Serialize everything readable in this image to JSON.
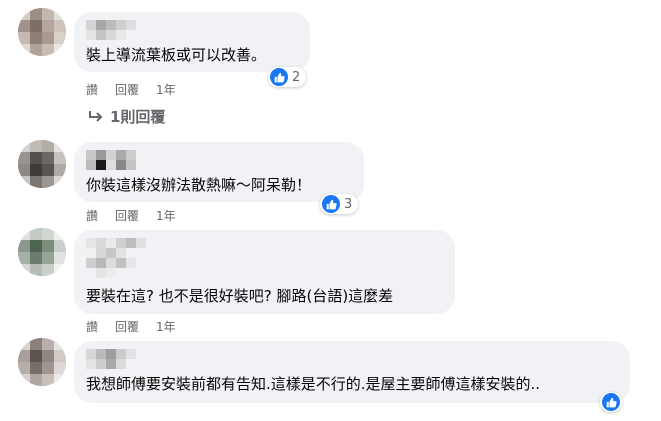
{
  "comments": [
    {
      "text": "裝上導流葉板或可以改善。",
      "reaction_count": "2",
      "actions": {
        "like": "讚",
        "reply": "回覆",
        "time": "1年"
      },
      "replies_label": "1則回覆"
    },
    {
      "text": "你裝這樣沒辦法散熱嘛～阿呆勒！",
      "reaction_count": "3",
      "actions": {
        "like": "讚",
        "reply": "回覆",
        "time": "1年"
      }
    },
    {
      "text": "要裝在這? 也不是很好裝吧? 腳路(台語)這麼差",
      "actions": {
        "like": "讚",
        "reply": "回覆",
        "time": "1年"
      }
    },
    {
      "text": "我想師傅要安裝前都有告知.這樣是不行的.是屋主要師傅這樣安裝的..",
      "reaction_count": ""
    }
  ],
  "icons": {
    "like_reaction": "thumbs-up-icon",
    "reply_arrow": "reply-arrow-icon"
  },
  "colors": {
    "bubble": "#f0f2f5",
    "meta_text": "#65676b",
    "like_blue": "#1877f2"
  }
}
